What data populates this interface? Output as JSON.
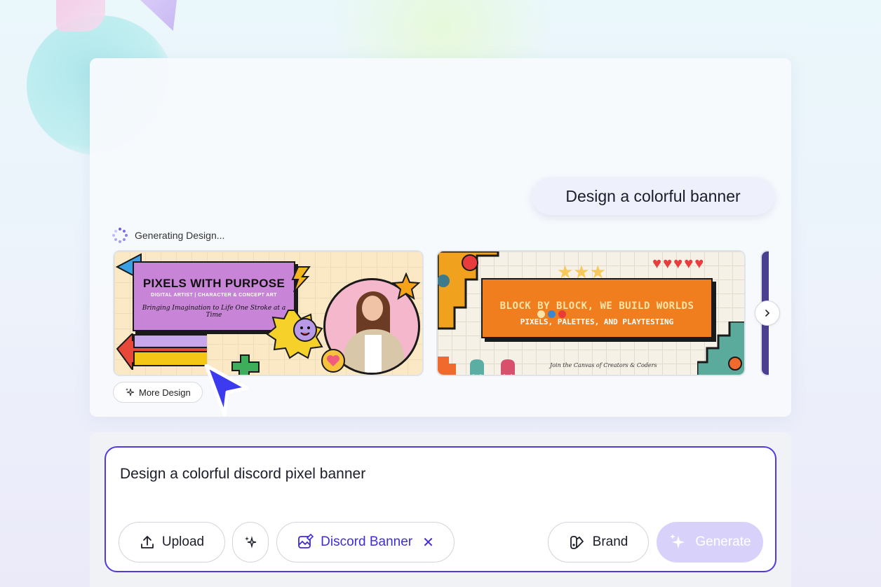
{
  "chat": {
    "user_prompt": "Design a colorful banner",
    "status_text": "Generating Design...",
    "more_design_label": "More Design"
  },
  "designs": [
    {
      "title": "PIXELS WITH PURPOSE",
      "subtitle": "DIGITAL ARTIST | CHARACTER & CONCEPT ART",
      "tagline": "Bringing Imagination to Life One Stroke at a Time"
    },
    {
      "title": "BLOCK BY BLOCK, WE BUILD WORLDS",
      "subtitle": "PIXELS, PALETTES, AND PLAYTESTING",
      "footer": "Join the Canvas of Creators & Coders"
    }
  ],
  "composer": {
    "input_value": "Design a colorful discord pixel banner",
    "upload_label": "Upload",
    "template_chip_label": "Discord Banner",
    "brand_label": "Brand",
    "generate_label": "Generate"
  },
  "icons": {
    "spinner": "loading-spinner-icon",
    "sparkle": "sparkle-icon",
    "next": "chevron-right-icon",
    "upload": "upload-icon",
    "template": "image-edit-icon",
    "close": "close-icon",
    "brand": "brand-palette-icon"
  },
  "colors": {
    "accent": "#4f3ae0",
    "chip_text": "#3e2cd8",
    "generate_disabled": "#d8d2fb"
  }
}
